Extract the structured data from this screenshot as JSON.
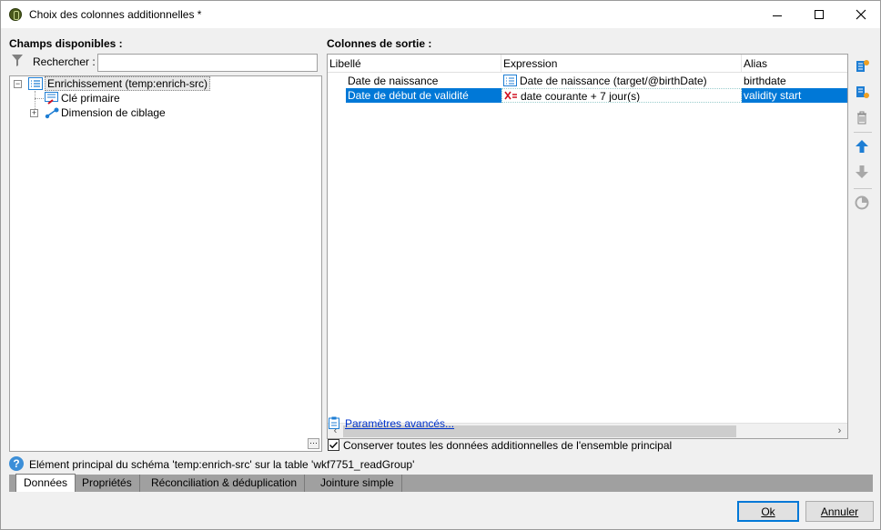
{
  "window": {
    "title": "Choix des colonnes additionnelles *",
    "minimize": "minimize",
    "maximize": "maximize",
    "close": "close"
  },
  "left": {
    "title": "Champs disponibles :",
    "search_label": "Rechercher :",
    "search_value": "",
    "tree": {
      "root_label": "Enrichissement (temp:enrich-src)",
      "child1_label": "Clé primaire",
      "child2_label": "Dimension de ciblage"
    },
    "ellipsis": "···"
  },
  "right": {
    "title": "Colonnes de sortie :",
    "columns": {
      "libelle": "Libellé",
      "expression": "Expression",
      "alias": "Alias"
    },
    "rows": [
      {
        "libelle": "Date de naissance",
        "expression": "Date de naissance (target/@birthDate)",
        "alias": "birthdate"
      },
      {
        "libelle": "Date de début de validité",
        "expression": "date courante + 7 jour(s)",
        "alias": "validity start"
      }
    ],
    "advanced_link": "Paramètres avancés...",
    "keep_label": "Conserver toutes les données additionnelles de l'ensemble principal",
    "keep_checked": true
  },
  "status": {
    "text": "Elément principal du schéma 'temp:enrich-src' sur la table 'wkf7751_readGroup'"
  },
  "tabs": [
    {
      "label": "Données"
    },
    {
      "label": "Propriétés"
    },
    {
      "label": "Réconciliation & déduplication"
    },
    {
      "label": "Jointure simple"
    }
  ],
  "buttons": {
    "ok_label": "Ok",
    "cancel_label": "Annuler"
  },
  "colors": {
    "selection": "#0078d7",
    "link": "#0033cc",
    "tool_blue": "#1e7ed4",
    "tool_orange": "#f0a020"
  }
}
